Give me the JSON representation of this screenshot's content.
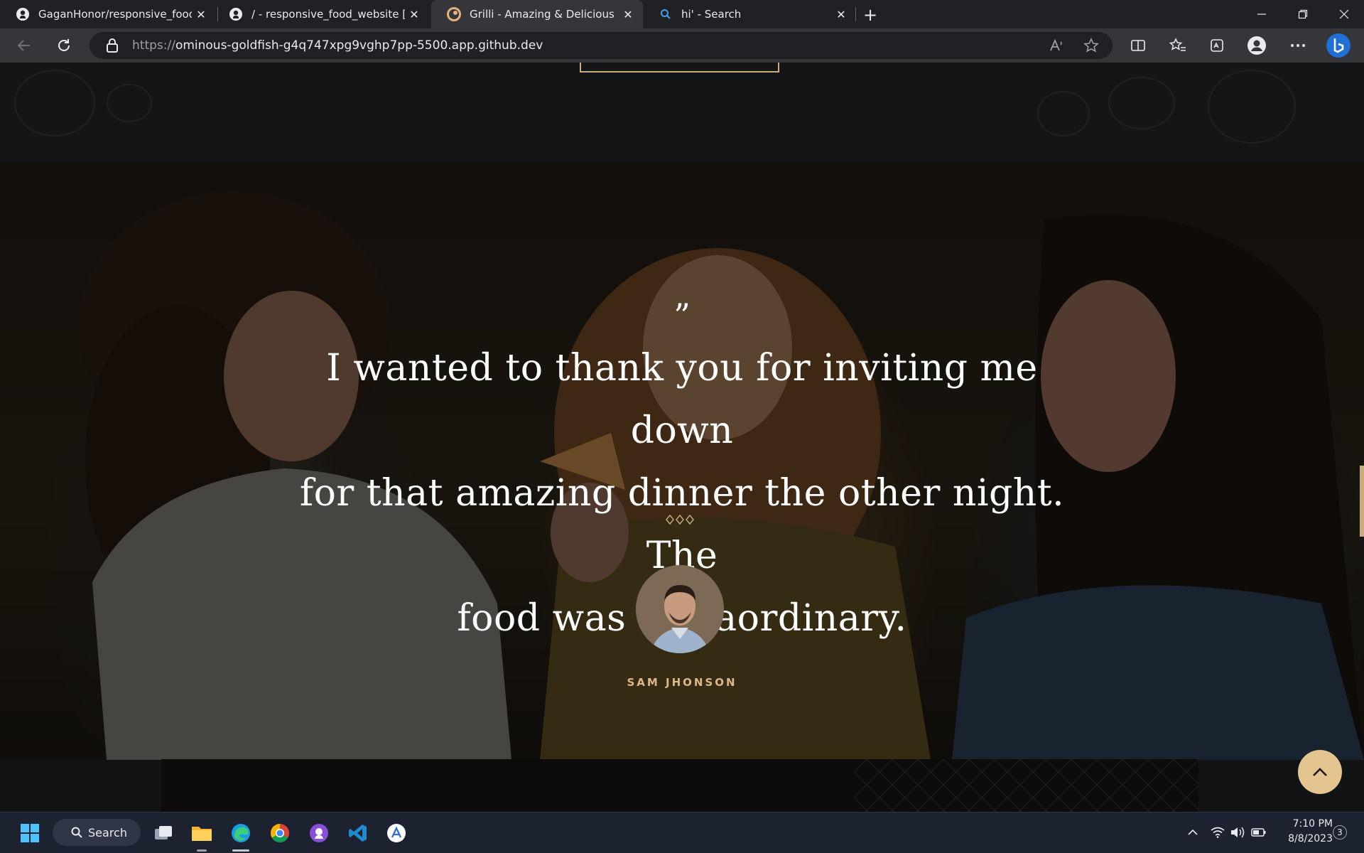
{
  "browser": {
    "tabs": [
      {
        "title": "GaganHonor/responsive_food_w",
        "icon": "github-icon"
      },
      {
        "title": "/ - responsive_food_website [Coc",
        "icon": "github-icon"
      },
      {
        "title": "Grilli - Amazing & Delicious Food",
        "icon": "site-favicon",
        "active": true
      },
      {
        "title": "hi' - Search",
        "icon": "bing-search-icon"
      }
    ],
    "url_scheme": "https://",
    "url_host": "ominous-goldfish-g4q747xpg9vghp7pp-5500.app.github.dev"
  },
  "testimonial": {
    "quote_mark": "”",
    "quote_line1": "I wanted to thank you for inviting me down",
    "quote_line2": "for that amazing dinner the other night. The",
    "quote_line3": "food was extraordinary.",
    "author": "SAM JHONSON"
  },
  "taskbar": {
    "search_label": "Search",
    "time": "7:10 PM",
    "date": "8/8/2023",
    "notification_count": "3"
  },
  "colors": {
    "accent": "#c9ab81",
    "back_to_top": "#e4c590",
    "author_name": "#d9b98a"
  }
}
